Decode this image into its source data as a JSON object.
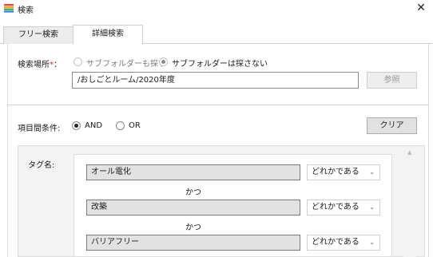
{
  "window": {
    "title": "検索",
    "close_glyph": "✕"
  },
  "tabs": [
    {
      "label": "フリー検索",
      "active": false
    },
    {
      "label": "詳細検索",
      "active": true
    }
  ],
  "search_location": {
    "label": "検索場所",
    "required_mark": "*",
    "colon": "：",
    "options": [
      {
        "label": "サブフォルダーも探す",
        "checked": false
      },
      {
        "label": "サブフォルダーは探さない",
        "checked": true
      }
    ],
    "path": "/おしごとルーム/2020年度",
    "browse_label": "参照"
  },
  "conditions": {
    "label": "項目間条件:",
    "options": [
      {
        "label": "AND",
        "checked": true
      },
      {
        "label": "OR",
        "checked": false
      }
    ],
    "clear_label": "クリア"
  },
  "tags": {
    "label": "タグ名:",
    "rows": [
      {
        "value": "オール電化",
        "match": "どれかである"
      },
      {
        "value": "改築",
        "match": "どれかである"
      },
      {
        "value": "バリアフリー",
        "match": "どれかである"
      }
    ],
    "connector": "かつ"
  },
  "colors": {
    "accent_icon": [
      "#e8443a",
      "#f4a225",
      "#3aa64a",
      "#2f7fd6"
    ],
    "required": "#e03030"
  }
}
